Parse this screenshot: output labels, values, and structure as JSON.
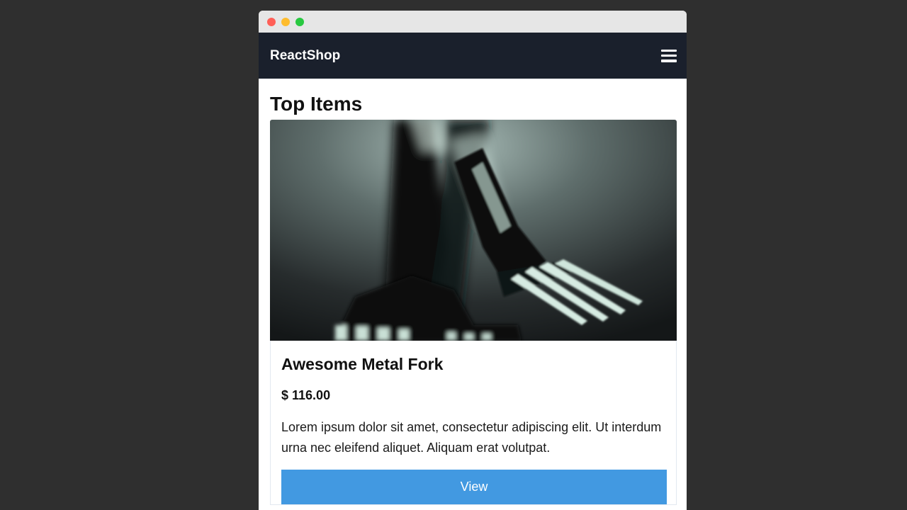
{
  "colors": {
    "desktop_bg": "#2f2f2f",
    "navbar_bg": "#1a202c",
    "button_bg": "#4299e1",
    "traffic_lights": [
      "#ff5f57",
      "#febc2e",
      "#28c840"
    ]
  },
  "navbar": {
    "brand": "ReactShop",
    "menu_icon": "hamburger-menu-icon"
  },
  "page": {
    "title": "Top Items"
  },
  "product": {
    "image_subject": "metal forks",
    "name": "Awesome Metal Fork",
    "price": "$ 116.00",
    "description": "Lorem ipsum dolor sit amet, consectetur adipiscing elit. Ut interdum urna nec eleifend aliquet. Aliquam erat volutpat.",
    "button_label": "View"
  }
}
